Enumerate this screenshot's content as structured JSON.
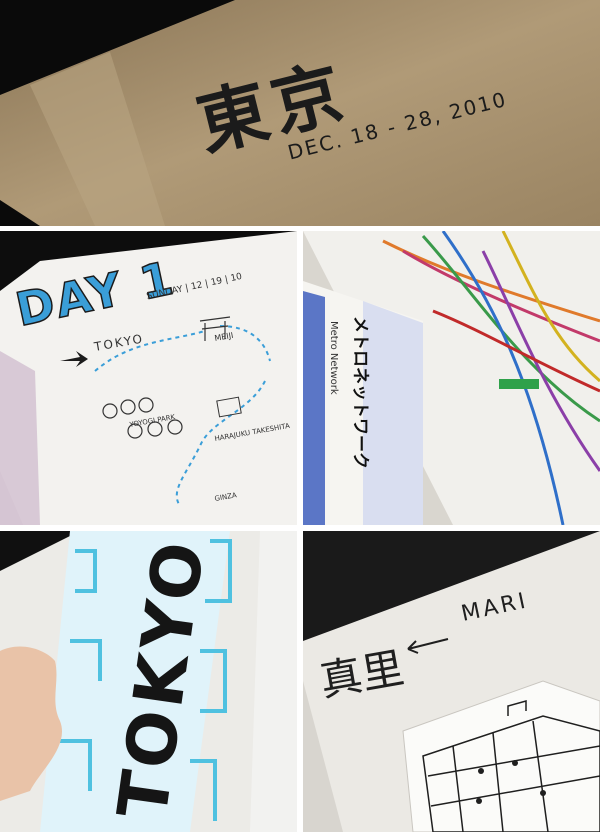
{
  "panel1": {
    "cover_kanji": "東京",
    "cover_dates": "DEC. 18 - 28, 2010",
    "colors": {
      "kraft": "#a9916c",
      "ink": "#1b1b1b"
    }
  },
  "panel2": {
    "day_heading": "DAY 1",
    "date_line": "SUNDAY | 12 | 19 | 10",
    "city_label": "TOKYO",
    "labels": [
      "MEIJI",
      "YOYOGI PARK",
      "HARAJUKU TAKESHITA",
      "GINZA"
    ],
    "colors": {
      "blue": "#3a9ed8"
    }
  },
  "panel3": {
    "brochure_title_ja": "メトロネットワーク",
    "brochure_title_en": "Metro Network",
    "colors": {
      "metro_blue": "#6f8fd6"
    }
  },
  "panel4": {
    "lettering": "TOKYO",
    "colors": {
      "cyan": "#4fc1e0",
      "ink": "#151515"
    }
  },
  "panel5": {
    "kanji": "真里",
    "arrow_label": "MARI"
  }
}
